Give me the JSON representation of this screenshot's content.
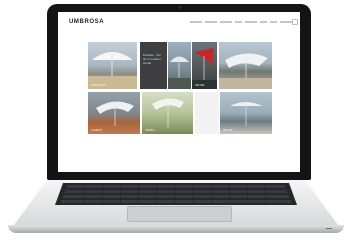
{
  "site": {
    "logo_text": "UMBROSA",
    "nav_items": [
      "",
      "",
      "",
      "",
      "",
      "",
      "",
      "",
      ""
    ]
  },
  "tiles": [
    {
      "label": "PARAFLEX"
    },
    {
      "label": "Paraflex · the art of outdoor shade"
    },
    {
      "label": ""
    },
    {
      "label": "INFINA"
    },
    {
      "label": ""
    },
    {
      "label": "ICARUS"
    },
    {
      "label": "VERSA"
    },
    {
      "label": ""
    },
    {
      "label": "INFINA"
    }
  ],
  "colors": {
    "laptop_bezel": "#141416",
    "keyboard": "#26272a",
    "accent_red": "#c8262b"
  }
}
